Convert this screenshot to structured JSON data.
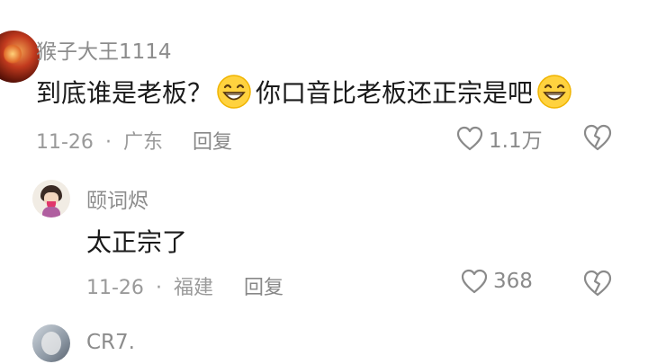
{
  "comments": [
    {
      "username": "猴子大王1114",
      "text_part1": "到底谁是老板？",
      "text_part2": "你口音比老板还正宗是吧",
      "emoji": "grinning-emoji",
      "date": "11-26",
      "separator": "·",
      "location": "广东",
      "reply_label": "回复",
      "likes": "1.1万"
    },
    {
      "username": "颐词烬",
      "text": "太正宗了",
      "date": "11-26",
      "separator": "·",
      "location": "福建",
      "reply_label": "回复",
      "likes": "368"
    },
    {
      "username": "CR7."
    }
  ],
  "colors": {
    "text": "#1a1a1a",
    "muted": "#8c8c8c",
    "emoji_yellow": "#ffd23f"
  }
}
